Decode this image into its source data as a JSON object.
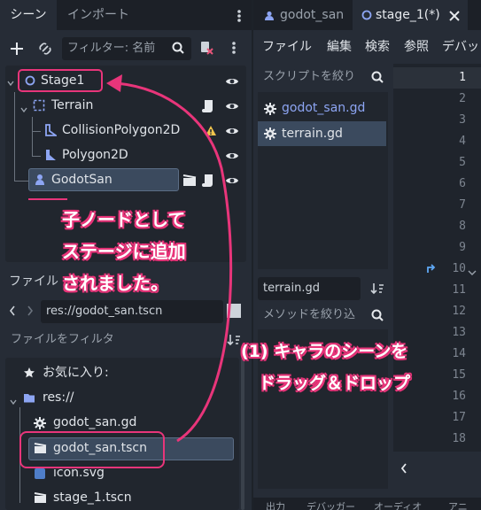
{
  "scene_dock": {
    "tabs": [
      "シーン",
      "インポート"
    ],
    "filter_placeholder": "フィルター: 名前",
    "nodes": [
      {
        "label": "Stage1"
      },
      {
        "label": "Terrain"
      },
      {
        "label": "CollisionPolygon2D"
      },
      {
        "label": "Polygon2D"
      },
      {
        "label": "GodotSan"
      }
    ]
  },
  "filesystem_dock": {
    "title": "ファイル",
    "path": "res://godot_san.tscn",
    "filter_placeholder": "ファイルをフィルタ",
    "favorites_label": "お気に入り:",
    "root_label": "res://",
    "files": [
      "godot_san.gd",
      "godot_san.tscn",
      "icon.svg",
      "stage_1.tscn"
    ]
  },
  "editor": {
    "tabs": [
      "godot_san",
      "stage_1(*)"
    ],
    "menu": [
      "ファイル",
      "編集",
      "検索",
      "参照",
      "デバッ"
    ],
    "script_filter_placeholder": "スクリプトを絞り",
    "scripts": [
      "godot_san.gd",
      "terrain.gd"
    ],
    "current_script": "terrain.gd",
    "method_filter_placeholder": "メソッドを絞り込",
    "line_numbers": [
      "1",
      "2",
      "3",
      "4",
      "5",
      "6",
      "7",
      "8",
      "9",
      "10",
      "11",
      "12",
      "13",
      "14",
      "15",
      "16",
      "17",
      "18"
    ],
    "bottom_tabs": [
      "出力",
      "デバッガー",
      "オーディオ",
      "アニ"
    ]
  },
  "annotations": {
    "label_child": [
      "子ノードとして",
      "ステージに追加",
      "されました。"
    ],
    "label_drag": [
      "(1) キャラのシーンを",
      "ドラッグ＆ドロップ"
    ]
  },
  "colors": {
    "accent": "#e8357a",
    "selection": "#3b4a5e",
    "panel": "#262c36"
  }
}
